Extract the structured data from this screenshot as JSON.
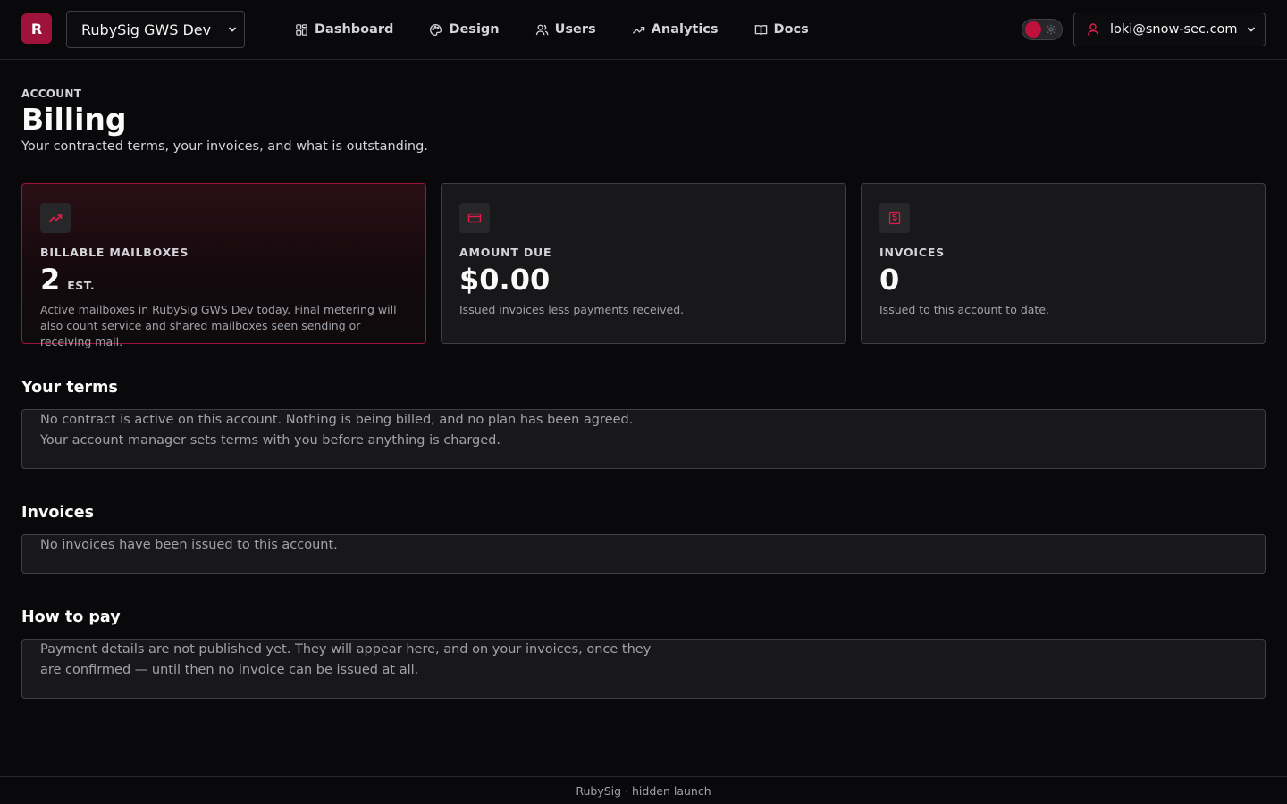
{
  "header": {
    "logo_letter": "R",
    "workspace": "RubySig GWS Dev",
    "nav": [
      {
        "label": "Dashboard",
        "icon": "grid-icon"
      },
      {
        "label": "Design",
        "icon": "palette-icon"
      },
      {
        "label": "Users",
        "icon": "users-icon"
      },
      {
        "label": "Analytics",
        "icon": "trend-icon"
      },
      {
        "label": "Docs",
        "icon": "book-icon"
      }
    ],
    "user_email": "loki@snow-sec.com"
  },
  "page": {
    "eyebrow": "ACCOUNT",
    "title": "Billing",
    "subtitle": "Your contracted terms, your invoices, and what is outstanding."
  },
  "cards": {
    "mailboxes": {
      "label": "BILLABLE MAILBOXES",
      "value": "2",
      "suffix": "EST.",
      "note": "Active mailboxes in RubySig GWS Dev today. Final metering will also count service and shared mailboxes seen sending or receiving mail."
    },
    "amount_due": {
      "label": "AMOUNT DUE",
      "value": "$0.00",
      "note": "Issued invoices less payments received."
    },
    "invoices": {
      "label": "INVOICES",
      "value": "0",
      "note": "Issued to this account to date."
    }
  },
  "sections": {
    "terms": {
      "title": "Your terms",
      "line1": "No contract is active on this account. Nothing is being billed, and no plan has been agreed.",
      "line2": "Your account manager sets terms with you before anything is charged."
    },
    "invoices": {
      "title": "Invoices",
      "line1": "No invoices have been issued to this account."
    },
    "how_to_pay": {
      "title": "How to pay",
      "line1": "Payment details are not published yet. They will appear here, and on your invoices, once they",
      "line2": "are confirmed — until then no invoice can be issued at all."
    }
  },
  "footer": {
    "text": "RubySig · hidden launch"
  },
  "colors": {
    "brand": "#9f1239",
    "accent_icon": "#e11d48",
    "background": "#09090b",
    "card": "#18181b",
    "border": "#3f3f46"
  }
}
